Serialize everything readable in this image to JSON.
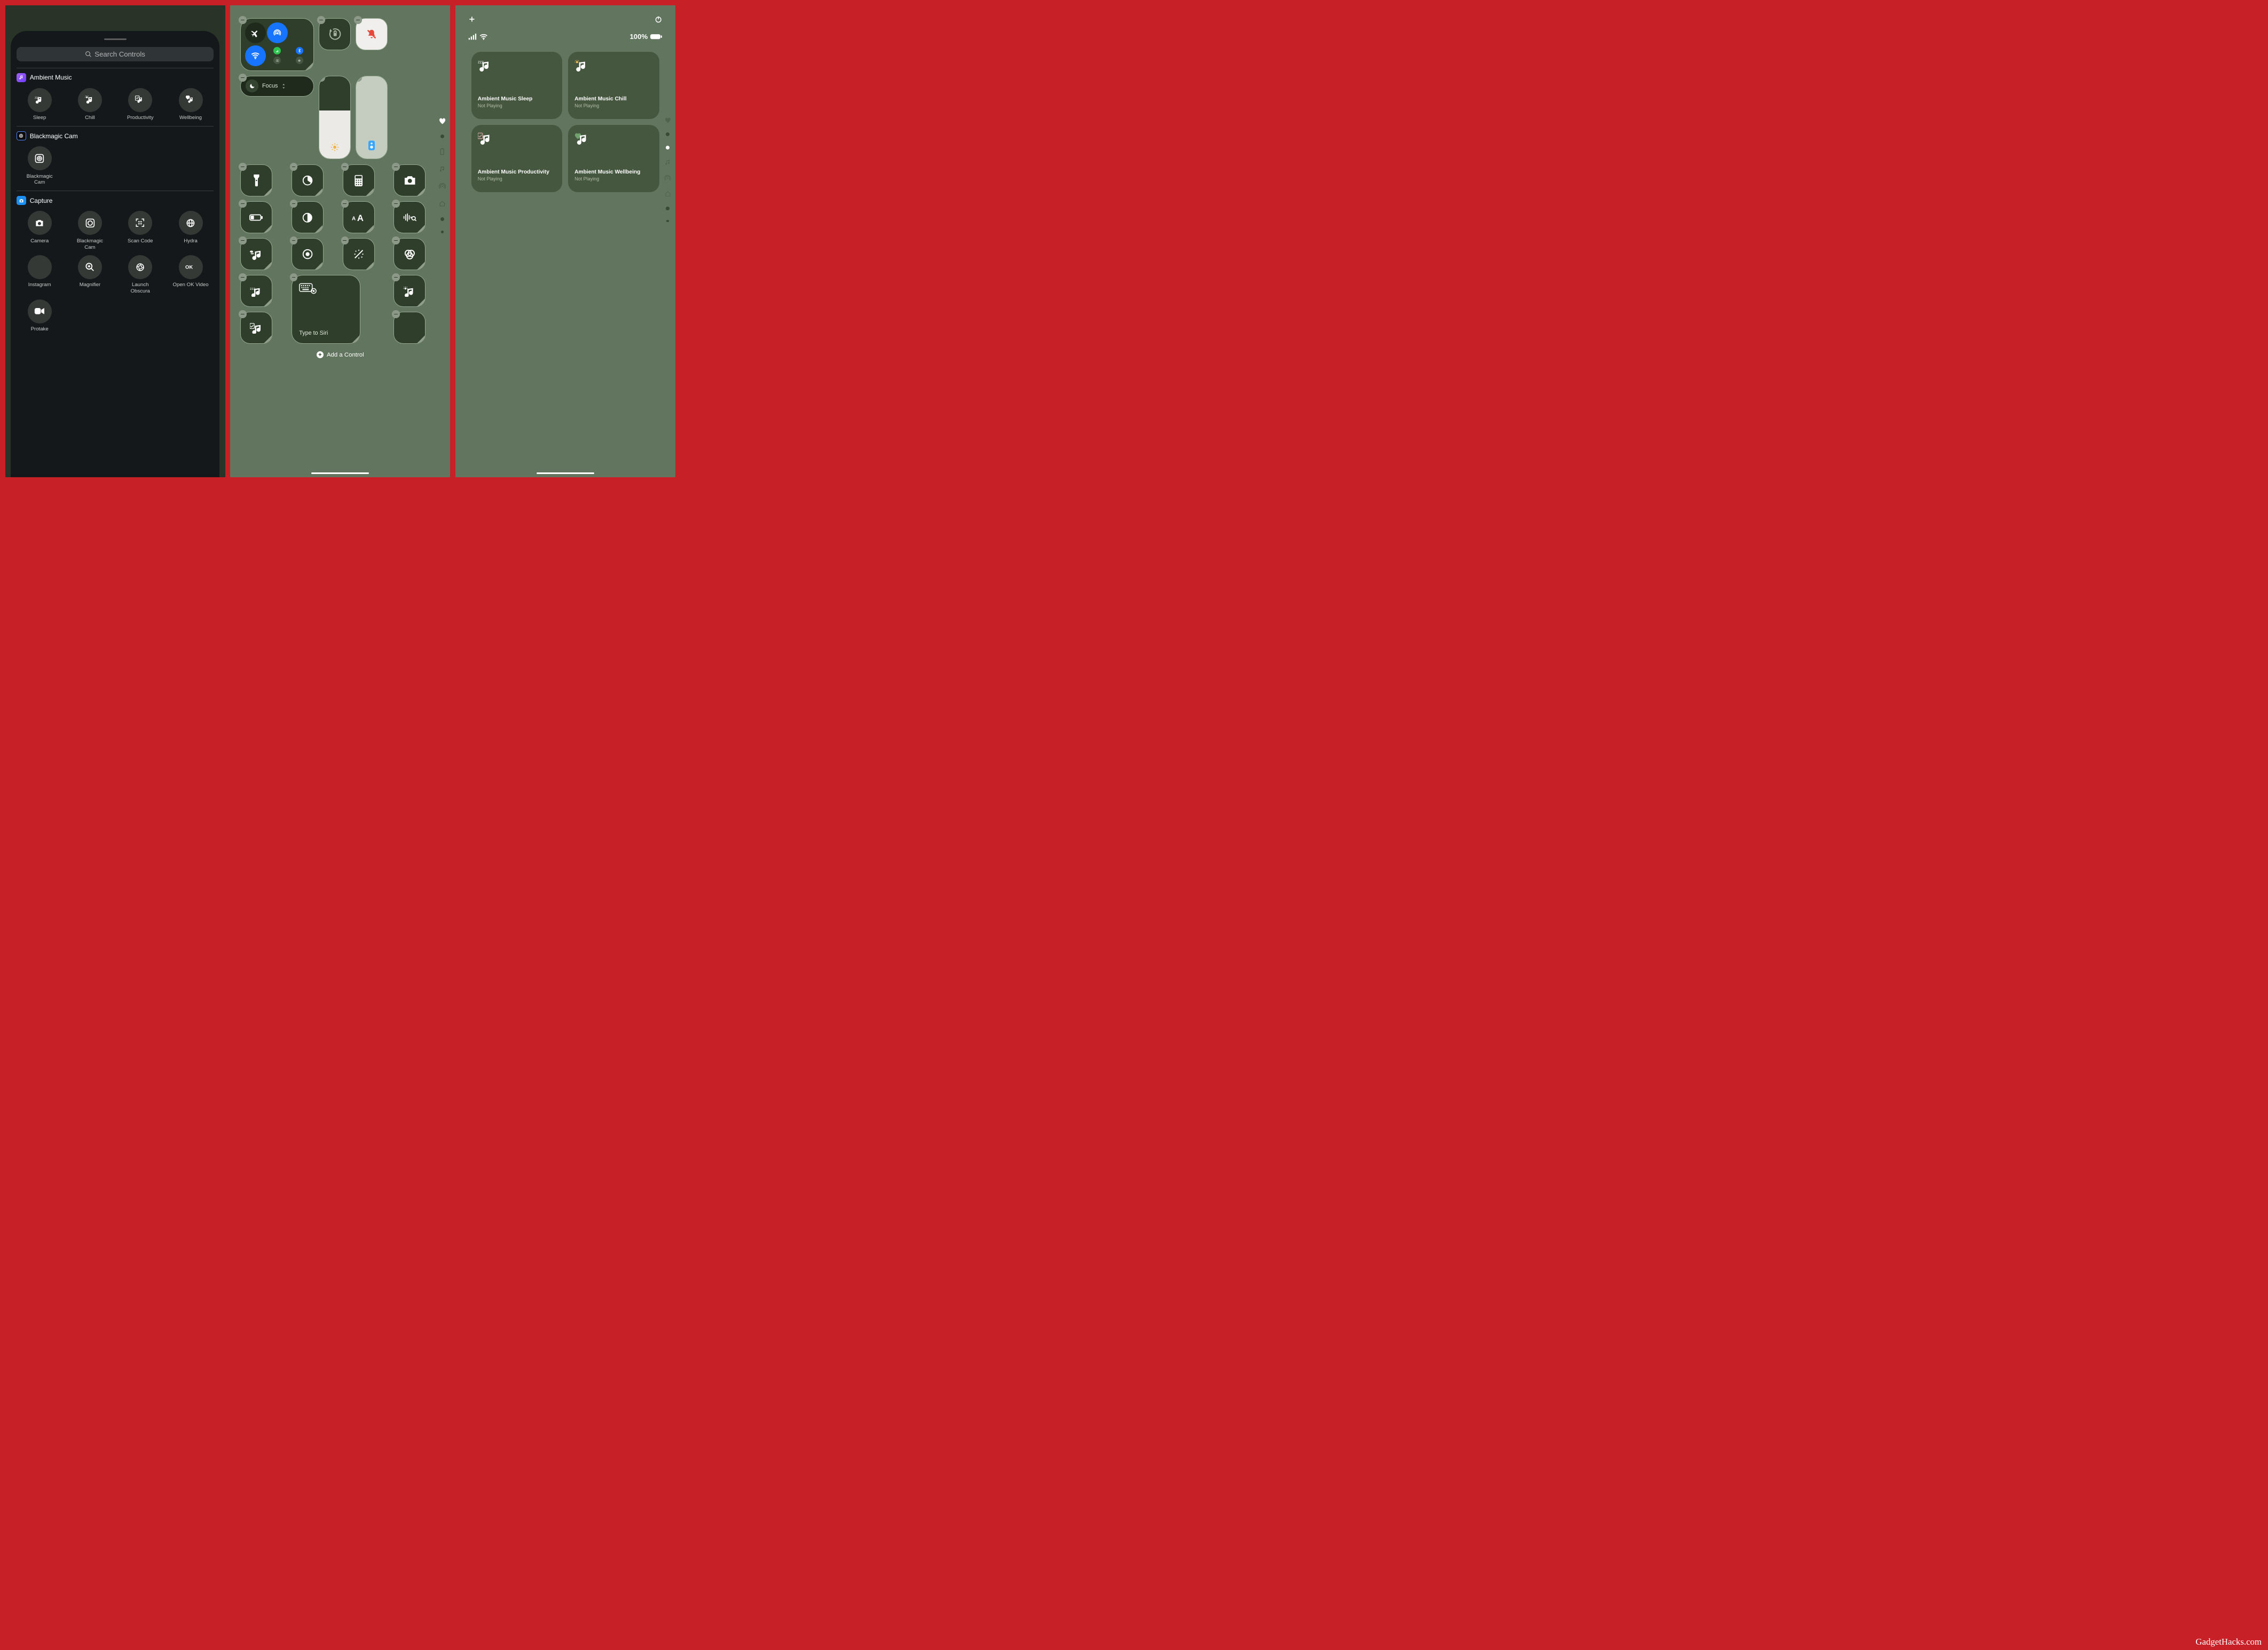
{
  "panel1": {
    "search_placeholder": "Search Controls",
    "sections": [
      {
        "id": "ambient",
        "title": "Ambient Music",
        "icon_color": "purple",
        "items": [
          "Sleep",
          "Chill",
          "Productivity",
          "Wellbeing"
        ]
      },
      {
        "id": "blackmagic",
        "title": "Blackmagic Cam",
        "icon_color": "black",
        "items": [
          "Blackmagic\nCam"
        ]
      },
      {
        "id": "capture",
        "title": "Capture",
        "icon_color": "blue",
        "items": [
          "Camera",
          "Blackmagic\nCam",
          "Scan Code",
          "Hydra",
          "Instagram",
          "Magnifier",
          "Launch\nObscura",
          "Open OK Video",
          "Protake"
        ]
      }
    ]
  },
  "panel2": {
    "focus_label": "Focus",
    "siri_label": "Type to Siri",
    "add_control_label": "Add a Control",
    "connectivity": {
      "airplane_on": false,
      "airdrop_on": true,
      "wifi_on": true,
      "cellular_on": true,
      "bluetooth_on": true
    },
    "orientation_locked": true,
    "silent_mode_on": true,
    "brightness_percent": 58,
    "icon_rows": [
      [
        "flashlight",
        "timer",
        "calculator",
        "camera"
      ],
      [
        "lowpower",
        "darkmode",
        "textsize",
        "soundrecognition"
      ],
      [
        "ambient-note",
        "",
        "",
        "screenrecord"
      ],
      [
        "accessibility",
        "",
        "",
        "colorfilters"
      ],
      [
        "sleep-music",
        "chill-music",
        "productivity-music",
        ""
      ]
    ],
    "rail_icons": [
      "heart",
      "dot",
      "battery",
      "music",
      "hotspot",
      "home",
      "dot",
      "dot"
    ]
  },
  "panel3": {
    "battery_text": "100%",
    "cards": [
      {
        "title": "Ambient Music Sleep",
        "sub": "Not Playing",
        "icon": "sleep"
      },
      {
        "title": "Ambient Music Chill",
        "sub": "Not Playing",
        "icon": "chill"
      },
      {
        "title": "Ambient Music Productivity",
        "sub": "Not Playing",
        "icon": "productivity"
      },
      {
        "title": "Ambient Music Wellbeing",
        "sub": "Not Playing",
        "icon": "wellbeing"
      }
    ],
    "rail": [
      "heart",
      "dot",
      "dot-active",
      "music",
      "hotspot",
      "home",
      "dot",
      "dot"
    ]
  },
  "watermark": "GadgetHacks.com"
}
